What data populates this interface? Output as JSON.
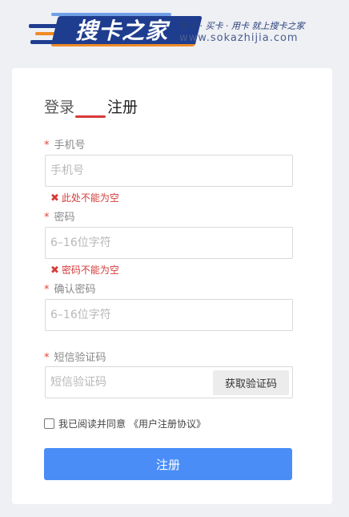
{
  "header": {
    "logo_name": "搜卡之家",
    "slogan": "看卡 · 买卡 · 用卡 就上搜卡之家",
    "url": "www.sokazhijia.com",
    "brand_color": "#1f3d8f",
    "accent_color": "#f08a24"
  },
  "tabs": [
    {
      "label": "登录",
      "active": false
    },
    {
      "label": "注册",
      "active": true
    }
  ],
  "form": {
    "phone": {
      "required_mark": "*",
      "label": "手机号",
      "placeholder": "手机号",
      "value": "",
      "error": "此处不能为空"
    },
    "password": {
      "required_mark": "*",
      "label": "密码",
      "placeholder": "6–16位字符",
      "value": "",
      "error": "密码不能为空"
    },
    "confirm": {
      "required_mark": "*",
      "label": "确认密码",
      "placeholder": "6–16位字符",
      "value": ""
    },
    "sms": {
      "required_mark": "*",
      "label": "短信验证码",
      "placeholder": "短信验证码",
      "value": "",
      "button_label": "获取验证码"
    },
    "error_icon": "✖",
    "agree": {
      "checked": false,
      "text": "我已阅读并同意",
      "link": "《用户注册协议》"
    },
    "submit_label": "注册"
  },
  "colors": {
    "primary_button": "#4a8df7",
    "error": "#d63a3a",
    "tab_underline": "#d63a3a",
    "page_bg": "#eef0f4"
  }
}
